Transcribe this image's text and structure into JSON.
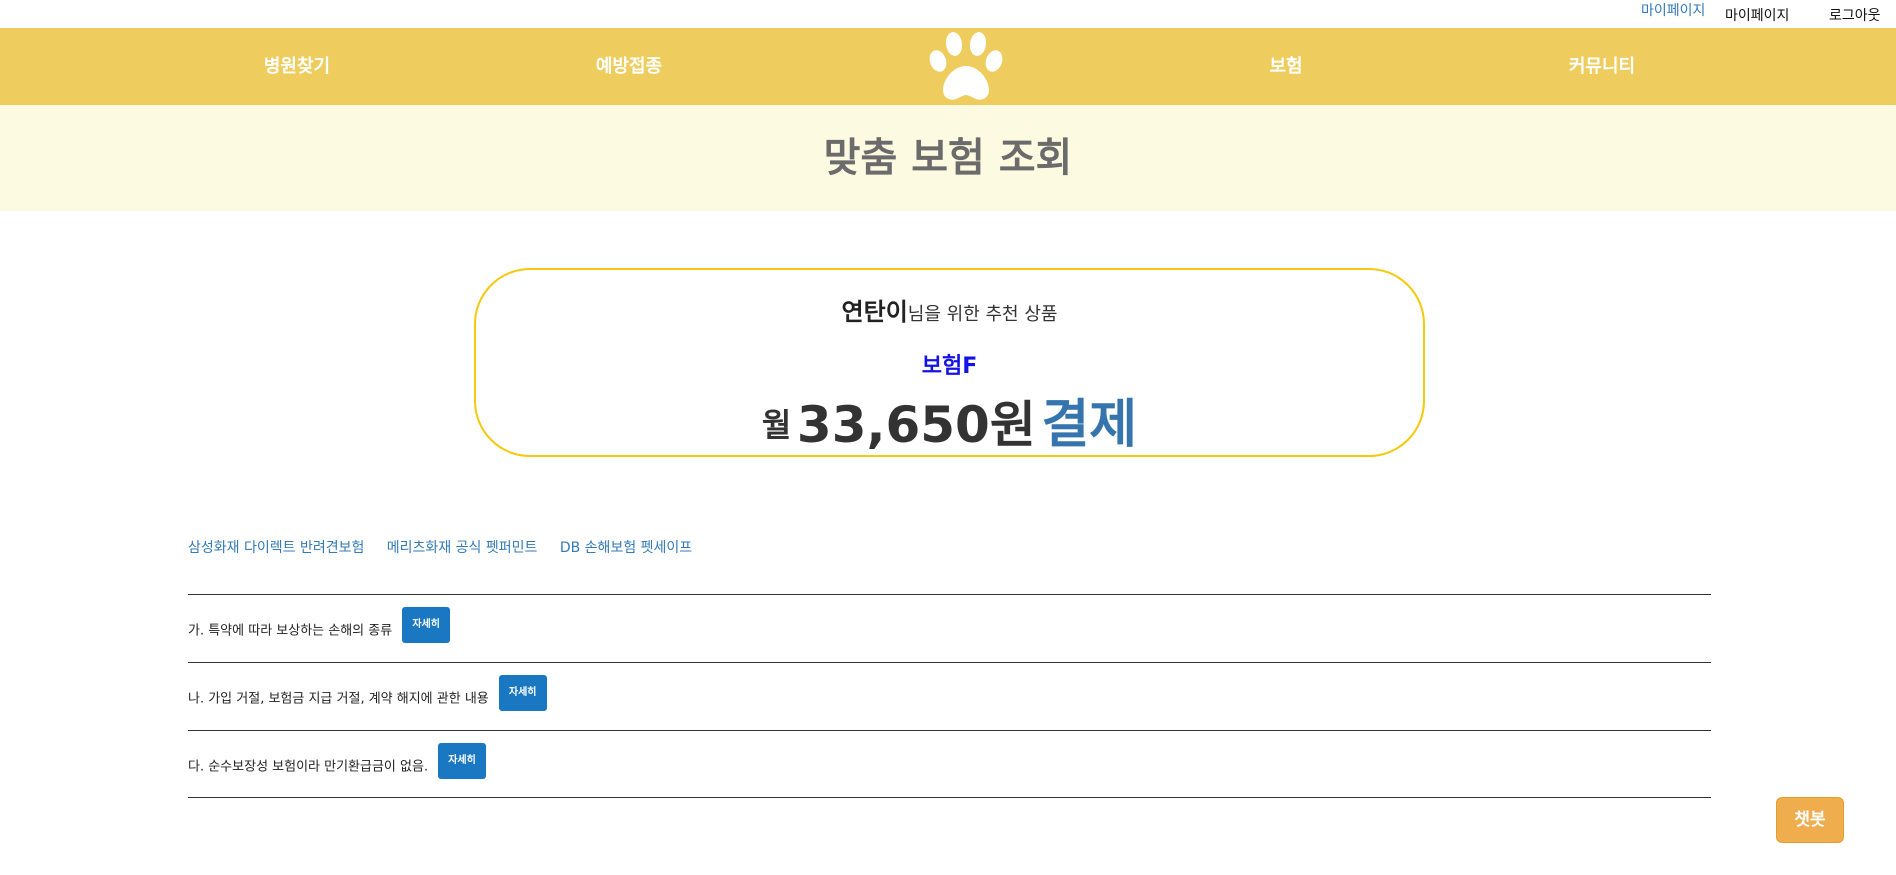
{
  "header": {
    "top_links": [
      {
        "label": "마이페이지"
      },
      {
        "label": "마이페이지"
      },
      {
        "label": "로그아웃"
      }
    ],
    "nav": [
      {
        "label": "병원찾기"
      },
      {
        "label": "예방접종"
      },
      {
        "label": "보험"
      },
      {
        "label": "커뮤니티"
      }
    ],
    "logo_icon": "paw-icon",
    "nav_color": "#eecd5e"
  },
  "hero": {
    "title": "맞춤 보험 조회",
    "bg_color": "#fcfbe1"
  },
  "card": {
    "pet_name": "연탄이",
    "subtitle_suffix": "님을 위한 추천 상품",
    "product_name": "보험F",
    "price_prefix": "월",
    "price": "33,650원",
    "pay_label": "결제",
    "border_color": "#f5c90e"
  },
  "insurer_links": [
    {
      "label": "삼성화재 다이렉트 반려견보험"
    },
    {
      "label": "메리츠화재 공식 펫퍼민트"
    },
    {
      "label": "DB 손해보험 펫세이프"
    }
  ],
  "terms": [
    {
      "text": "가. 특약에 따라 보상하는 손해의 종류",
      "button": "자세히"
    },
    {
      "text": "나. 가입 거절, 보험금 지급 거절, 계약 해지에 관한 내용",
      "button": "자세히"
    },
    {
      "text": "다. 순수보장성 보험이라 만기환급금이 없음.",
      "button": "자세히"
    }
  ],
  "chatbot": {
    "label": "챗봇",
    "color": "#f0ad4e"
  }
}
